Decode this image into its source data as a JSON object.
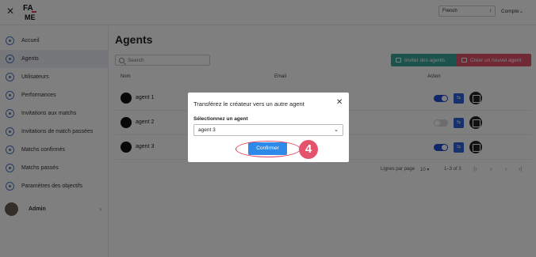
{
  "header": {
    "logo_text": "FA ME",
    "language": "French",
    "account": "Compte"
  },
  "sidebar": {
    "items": [
      {
        "label": "Accueil",
        "icon": "home-icon"
      },
      {
        "label": "Agents",
        "icon": "user-icon",
        "active": true
      },
      {
        "label": "Utilisateurs",
        "icon": "users-icon"
      },
      {
        "label": "Performances",
        "icon": "chart-icon"
      },
      {
        "label": "Invitations aux matchs",
        "icon": "mail-icon"
      },
      {
        "label": "Invitations de match passées",
        "icon": "history-icon"
      },
      {
        "label": "Matchs confirmés",
        "icon": "check-icon"
      },
      {
        "label": "Matchs passés",
        "icon": "clock-icon"
      },
      {
        "label": "Paramètres des objectifs",
        "icon": "gear-icon"
      }
    ],
    "user": {
      "name": "Admin"
    }
  },
  "main": {
    "title": "Agents",
    "search_placeholder": "Search",
    "invite_button": "Inviter des agents",
    "create_button": "Créer un nouvel agent",
    "columns": {
      "name": "Nom",
      "email": "Email",
      "action": "Action"
    },
    "rows": [
      {
        "name": "agent 1",
        "active": true
      },
      {
        "name": "agent 2",
        "active": false
      },
      {
        "name": "agent 3",
        "active": true
      }
    ],
    "pagination": {
      "rows_per_page_label": "Lignes par page",
      "rows_per_page": "10",
      "range": "1–3 of 3"
    }
  },
  "modal": {
    "title": "Transférez le créateur vers un autre agent",
    "select_label": "Sélectionnez un agent",
    "selected_agent": "agent 3",
    "confirm_button": "Confirmer"
  },
  "annotation": {
    "step": "4"
  },
  "colors": {
    "accent_blue": "#2d8ae8",
    "green_button": "#3aa79a",
    "red_button": "#e0536b",
    "annotation_red": "#e4526c"
  }
}
